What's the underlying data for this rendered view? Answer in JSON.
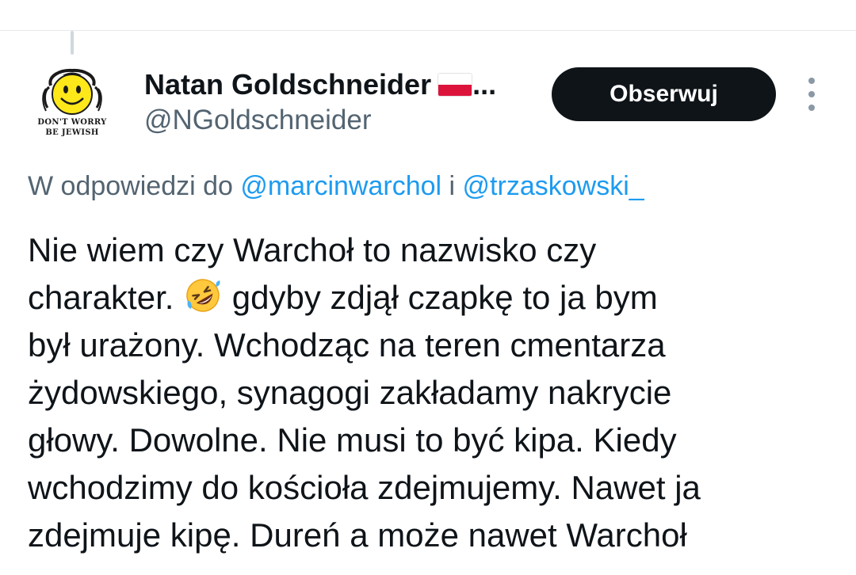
{
  "author": {
    "display_name": "Natan Goldschneider",
    "name_suffix": "...",
    "flag": "poland-flag",
    "handle": "@NGoldschneider",
    "avatar_text_line1": "DON'T WORRY",
    "avatar_text_line2": "BE JEWISH"
  },
  "actions": {
    "follow_label": "Obserwuj",
    "more_icon": "more-vertical-icon"
  },
  "reply_context": {
    "prefix": "W odpowiedzi do",
    "mention1": "@marcinwarchol",
    "conjunction": "i",
    "mention2": "@trzaskowski_"
  },
  "tweet": {
    "line1": "Nie wiem czy Warchoł to nazwisko czy",
    "line2_before": "charakter.",
    "line2_emoji": "rolling-on-floor-laughing-emoji",
    "line2_after": "gdyby zdjął czapkę to ja bym",
    "line3": "był urażony. Wchodząc na teren cmentarza",
    "line4": "żydowskiego, synagogi zakładamy nakrycie",
    "line5": "głowy. Dowolne. Nie musi to być kipa. Kiedy",
    "line6": "wchodzimy do kościoła zdejmujemy. Nawet ja",
    "line7": "zdejmuje kipę. Dureń a może nawet Warchoł"
  },
  "colors": {
    "accent": "#1d9bf0",
    "text_primary": "#0f1419",
    "text_secondary": "#536471",
    "button_bg": "#0f1419"
  }
}
